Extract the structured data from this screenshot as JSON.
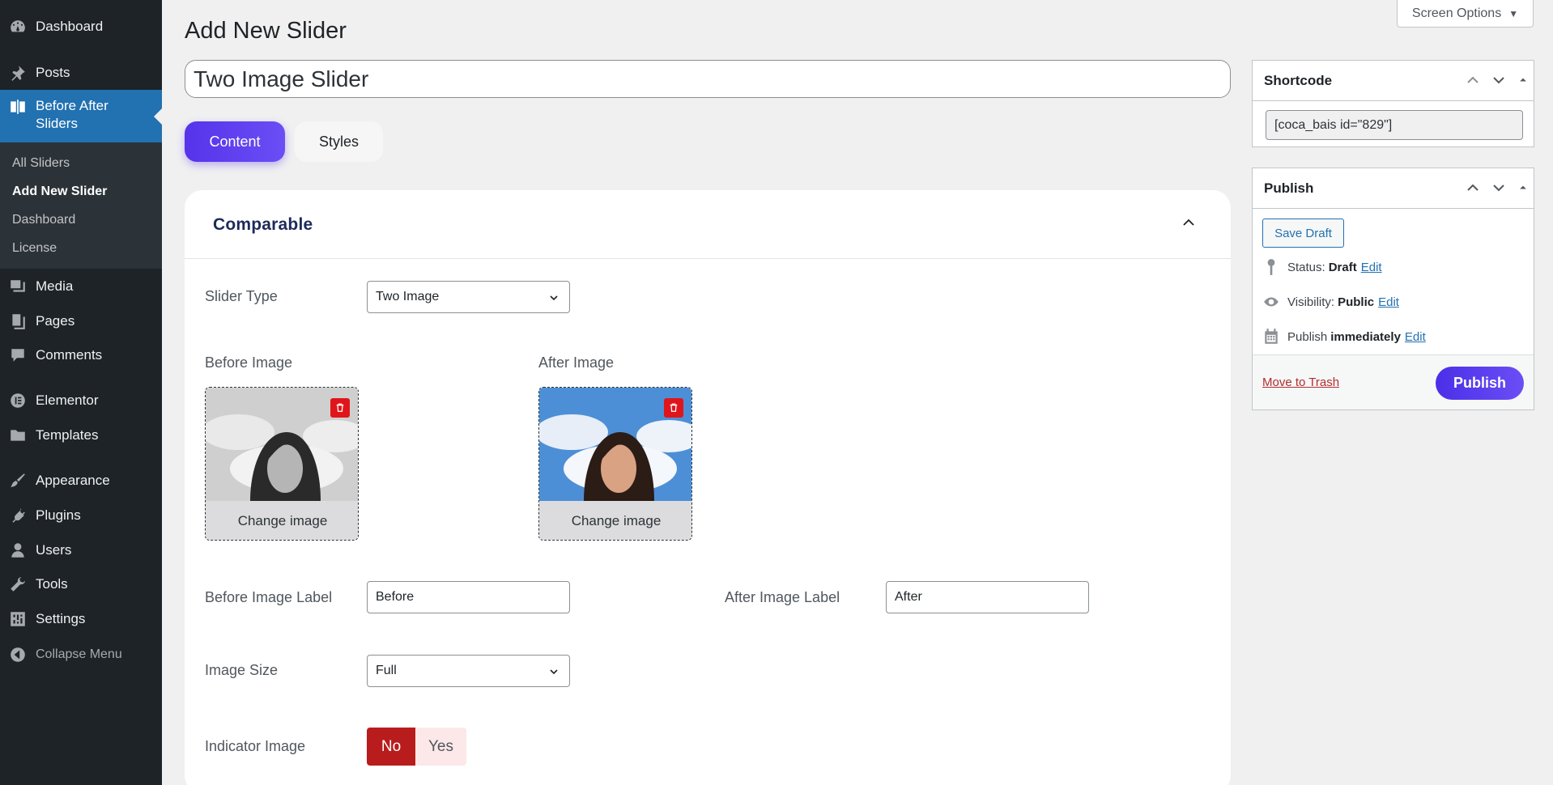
{
  "sidebar": {
    "items": [
      {
        "label": "Dashboard",
        "icon": "dashboard-icon"
      },
      {
        "label": "Posts",
        "icon": "pin-icon"
      },
      {
        "label": "Before After Sliders",
        "icon": "slider-icon"
      },
      {
        "label": "Media",
        "icon": "media-icon"
      },
      {
        "label": "Pages",
        "icon": "pages-icon"
      },
      {
        "label": "Comments",
        "icon": "comments-icon"
      },
      {
        "label": "Elementor",
        "icon": "elementor-icon"
      },
      {
        "label": "Templates",
        "icon": "folder-icon"
      },
      {
        "label": "Appearance",
        "icon": "brush-icon"
      },
      {
        "label": "Plugins",
        "icon": "plug-icon"
      },
      {
        "label": "Users",
        "icon": "user-icon"
      },
      {
        "label": "Tools",
        "icon": "wrench-icon"
      },
      {
        "label": "Settings",
        "icon": "settings-icon"
      }
    ],
    "submenu": [
      "All Sliders",
      "Add New Slider",
      "Dashboard",
      "License"
    ],
    "collapse_label": "Collapse Menu"
  },
  "header": {
    "page_title": "Add New Slider",
    "screen_options": "Screen Options"
  },
  "editor": {
    "title_value": "Two Image Slider",
    "tabs": {
      "content": "Content",
      "styles": "Styles"
    }
  },
  "card": {
    "title": "Comparable",
    "slider_type": {
      "label": "Slider Type",
      "value": "Two Image"
    },
    "before_image": {
      "label": "Before Image",
      "change": "Change image"
    },
    "after_image": {
      "label": "After Image",
      "change": "Change image"
    },
    "before_label": {
      "label": "Before Image Label",
      "value": "Before"
    },
    "after_label": {
      "label": "After Image Label",
      "value": "After"
    },
    "image_size": {
      "label": "Image Size",
      "value": "Full"
    },
    "indicator": {
      "label": "Indicator Image",
      "no": "No",
      "yes": "Yes"
    }
  },
  "shortcode": {
    "title": "Shortcode",
    "value": "[coca_bais id=\"829\"]"
  },
  "publish": {
    "title": "Publish",
    "save_draft": "Save Draft",
    "status_label": "Status:",
    "status_value": "Draft",
    "visibility_label": "Visibility:",
    "visibility_value": "Public",
    "publish_label": "Publish",
    "publish_value": "immediately",
    "edit": "Edit",
    "move_to_trash": "Move to Trash",
    "publish_button": "Publish"
  },
  "colors": {
    "sidebar_bg": "#1d2327",
    "active_menu": "#2271b1",
    "accent": "#5633ea",
    "toggle_no": "#b91c1c",
    "trash_red": "#e0151b"
  }
}
